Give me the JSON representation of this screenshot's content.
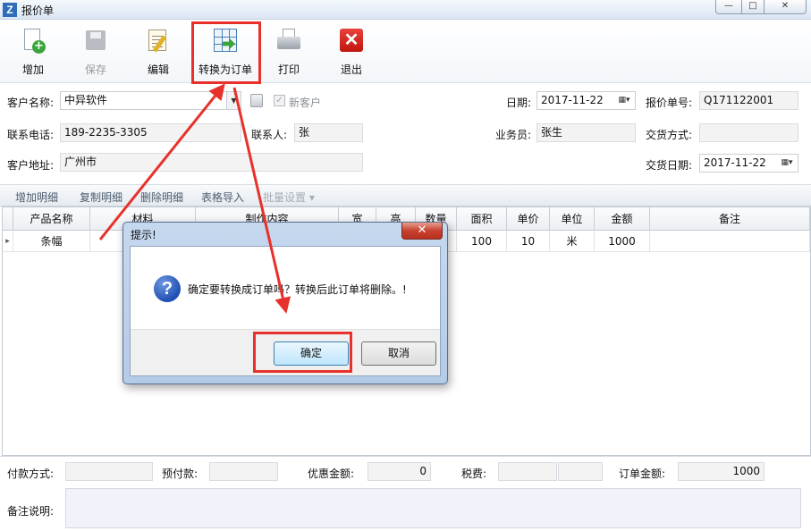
{
  "window": {
    "title": "报价单",
    "app_icon_letter": "Z",
    "min_glyph": "—",
    "max_glyph": "□",
    "close_glyph": "✕"
  },
  "toolbar": {
    "add": "增加",
    "save": "保存",
    "edit": "编辑",
    "convert": "转换为订单",
    "print": "打印",
    "exit": "退出"
  },
  "form": {
    "customer_name_label": "客户名称:",
    "customer_name": "中异软件",
    "new_customer_label": "新客户",
    "phone_label": "联系电话:",
    "phone": "189-2235-3305",
    "contact_label": "联系人:",
    "contact": "张",
    "address_label": "客户地址:",
    "address": "广州市",
    "date_label": "日期:",
    "date": "2017-11-22",
    "quote_no_label": "报价单号:",
    "quote_no": "Q171122001",
    "salesman_label": "业务员:",
    "salesman": "张生",
    "trade_mode_label": "交货方式:",
    "trade_mode": "",
    "delivery_date_label": "交货日期:",
    "delivery_date": "2017-11-22"
  },
  "detail_toolbar": {
    "add_detail": "增加明细",
    "copy_detail": "复制明细",
    "delete_detail": "删除明细",
    "import_table": "表格导入",
    "batch_settings": "批量设置 ▾"
  },
  "grid": {
    "headers": [
      "产品名称",
      "材料",
      "制作内容",
      "宽",
      "高",
      "数量",
      "面积",
      "单价",
      "单位",
      "金额",
      "备注"
    ],
    "row": {
      "marker": "▸",
      "product": "条幅",
      "material": "",
      "content": "",
      "width": "",
      "height": "",
      "qty": "",
      "area": "100",
      "price": "10",
      "unit": "米",
      "amount": "1000",
      "remark": ""
    }
  },
  "footer": {
    "payment_label": "付款方式:",
    "payment": "",
    "prepay_label": "预付款:",
    "prepay": "",
    "discount_label": "优惠金额:",
    "discount": "0",
    "tax_label": "税费:",
    "tax": "",
    "order_amount_label": "订单金额:",
    "order_amount": "1000",
    "remark_label": "备注说明:"
  },
  "dialog": {
    "title": "提示!",
    "close_glyph": "✕",
    "icon_glyph": "?",
    "message": "确定要转换成订单吗？转换后此订单将删除。!",
    "ok": "确定",
    "cancel": "取消"
  },
  "colors": {
    "annotation_red": "#e8312a",
    "ok_button_blue": "#3c7fb1",
    "dialog_frame": "#b4cbe6"
  }
}
